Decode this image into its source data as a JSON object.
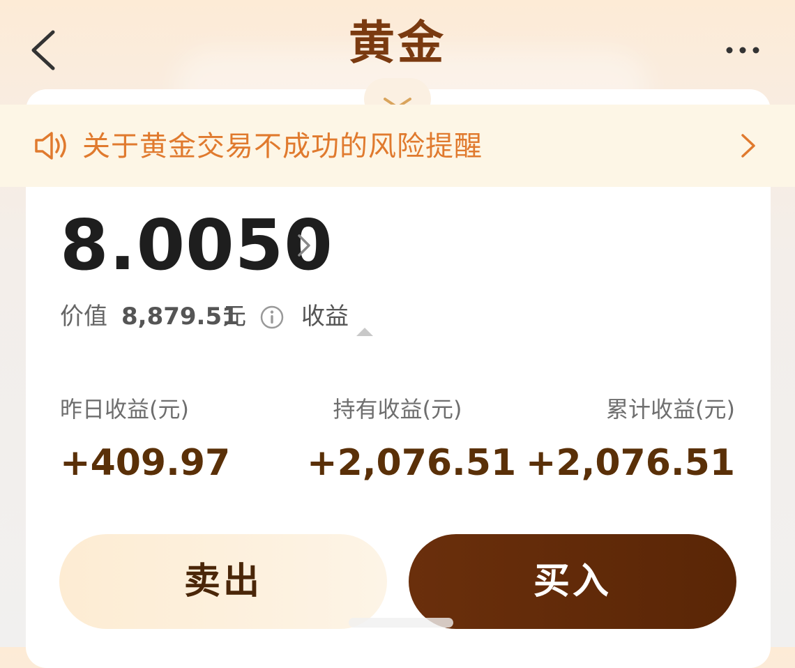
{
  "header": {
    "title": "黄金"
  },
  "notice": {
    "text": "关于黄金交易不成功的风险提醒"
  },
  "holding": {
    "amount": "8.0050",
    "value_label": "价值",
    "value_amount": "8,879.51",
    "value_unit": "元",
    "profit_toggle_label": "收益"
  },
  "stats": [
    {
      "label": "昨日收益(元)",
      "value": "+409.97"
    },
    {
      "label": "持有收益(元)",
      "value": "+2,076.51"
    },
    {
      "label": "累计收益(元)",
      "value": "+2,076.51"
    }
  ],
  "actions": {
    "sell_label": "卖出",
    "buy_label": "买入"
  },
  "colors": {
    "title": "#7a3a10",
    "notice_text": "#e07a2e",
    "profit_value": "#5a3008",
    "buy_button": "#5a2606",
    "sell_button": "#fdecd3"
  },
  "icons": {
    "back": "back-arrow-icon",
    "more": "more-dots-icon",
    "speaker": "speaker-icon",
    "chevron": "chevron-right-icon",
    "info": "info-icon",
    "caret": "caret-up-icon"
  }
}
